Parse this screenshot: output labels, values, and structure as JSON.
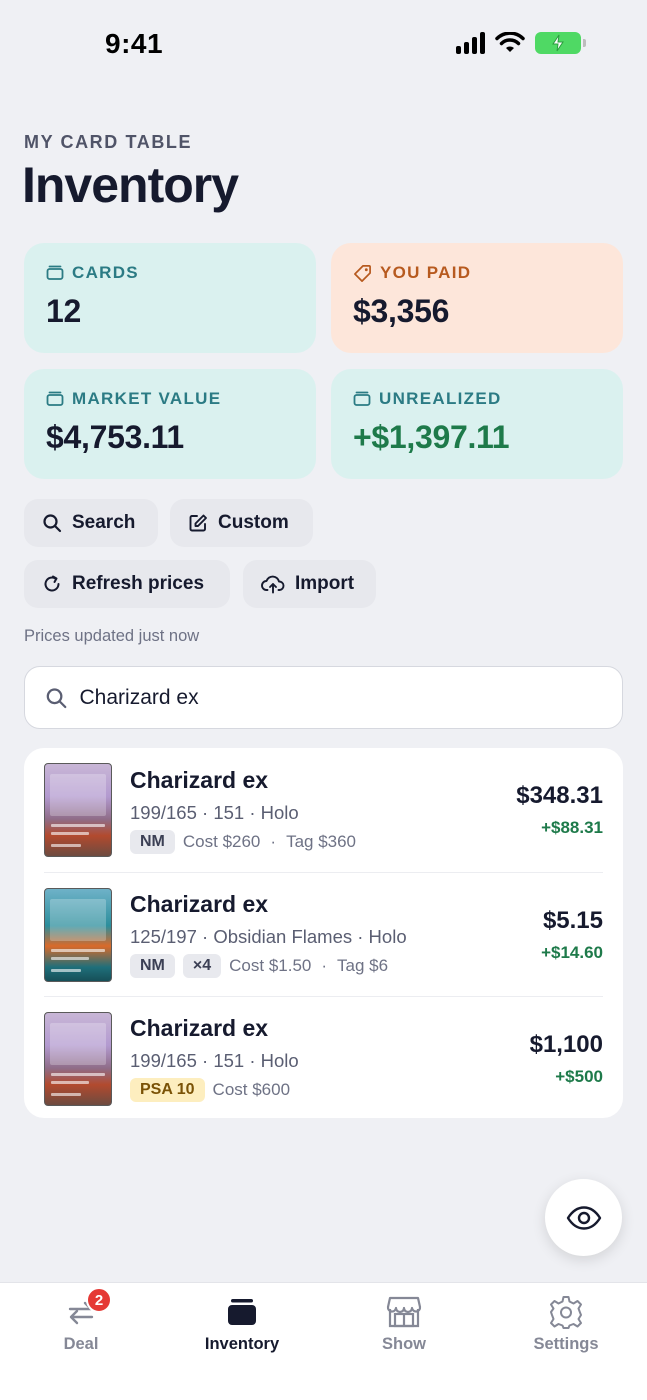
{
  "status_bar": {
    "time": "9:41"
  },
  "header": {
    "eyebrow": "MY CARD TABLE",
    "title": "Inventory"
  },
  "stats": {
    "cards": {
      "label": "CARDS",
      "value": "12"
    },
    "paid": {
      "label": "YOU PAID",
      "value": "$3,356"
    },
    "market": {
      "label": "MARKET VALUE",
      "value": "$4,753.11"
    },
    "unrealized": {
      "label": "UNREALIZED",
      "value": "+$1,397.11"
    }
  },
  "actions": {
    "search": "Search",
    "custom": "Custom",
    "refresh": "Refresh prices",
    "import": "Import"
  },
  "prices_updated": "Prices updated just now",
  "search": {
    "value": "Charizard ex"
  },
  "cards": [
    {
      "name": "Charizard ex",
      "set": "199/165 · 151 · Holo",
      "condition": "NM",
      "quantity": "",
      "cost": "Cost $260",
      "sep": "·",
      "tag": "Tag $360",
      "price": "$348.31",
      "change": "+$88.31"
    },
    {
      "name": "Charizard ex",
      "set": "125/197 · Obsidian Flames · Holo",
      "condition": "NM",
      "quantity": "×4",
      "cost": "Cost $1.50",
      "sep": "·",
      "tag": "Tag $6",
      "price": "$5.15",
      "change": "+$14.60"
    },
    {
      "name": "Charizard ex",
      "set": "199/165 · 151 · Holo",
      "condition": "PSA 10",
      "quantity": "",
      "cost": "Cost $600",
      "sep": "",
      "tag": "",
      "price": "$1,100",
      "change": "+$500"
    }
  ],
  "tabs": {
    "deal": {
      "label": "Deal",
      "badge": "2"
    },
    "inventory": {
      "label": "Inventory"
    },
    "show": {
      "label": "Show"
    },
    "settings": {
      "label": "Settings"
    }
  },
  "colors": {
    "accent_green": "#1e7a4a",
    "teal_card": "#daf1ef",
    "peach_card": "#fde6da",
    "badge_red": "#e53935"
  },
  "icons": [
    "card-stack-icon",
    "tag-icon",
    "search-icon",
    "edit-icon",
    "refresh-icon",
    "cloud-upload-icon",
    "eye-icon",
    "swap-arrows-icon",
    "storefront-icon",
    "gear-icon"
  ]
}
